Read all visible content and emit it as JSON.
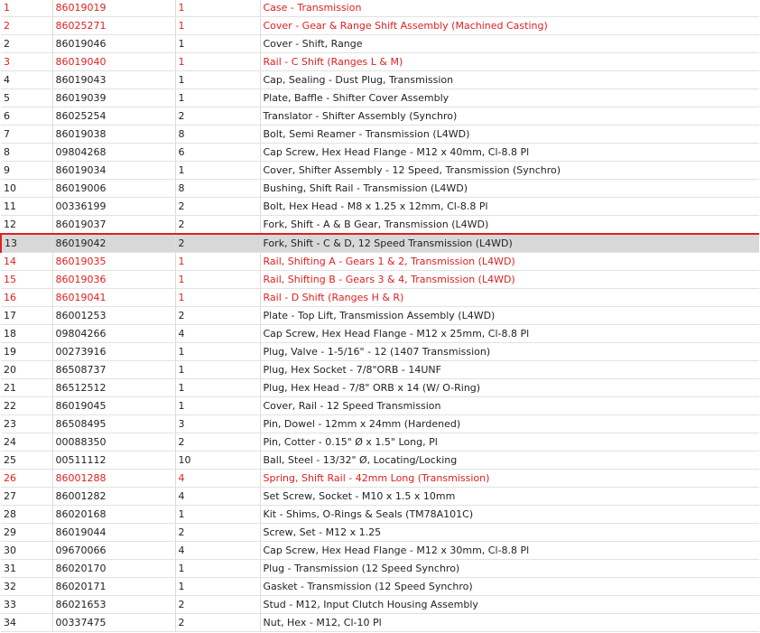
{
  "parts_table": {
    "selected_ref": "13",
    "rows": [
      {
        "ref": "1",
        "part_number": "86019019",
        "qty": "1",
        "description": "Case - Transmission",
        "highlight": "red"
      },
      {
        "ref": "2",
        "part_number": "86025271",
        "qty": "1",
        "description": "Cover - Gear & Range Shift Assembly (Machined Casting)",
        "highlight": "red"
      },
      {
        "ref": "2",
        "part_number": "86019046",
        "qty": "1",
        "description": "Cover - Shift, Range",
        "highlight": "none"
      },
      {
        "ref": "3",
        "part_number": "86019040",
        "qty": "1",
        "description": "Rail - C Shift (Ranges L & M)",
        "highlight": "red"
      },
      {
        "ref": "4",
        "part_number": "86019043",
        "qty": "1",
        "description": "Cap, Sealing - Dust Plug, Transmission",
        "highlight": "none"
      },
      {
        "ref": "5",
        "part_number": "86019039",
        "qty": "1",
        "description": "Plate, Baffle - Shifter Cover Assembly",
        "highlight": "none"
      },
      {
        "ref": "6",
        "part_number": "86025254",
        "qty": "2",
        "description": "Translator - Shifter Assembly (Synchro)",
        "highlight": "none"
      },
      {
        "ref": "7",
        "part_number": "86019038",
        "qty": "8",
        "description": "Bolt, Semi Reamer - Transmission (L4WD)",
        "highlight": "none"
      },
      {
        "ref": "8",
        "part_number": "09804268",
        "qty": "6",
        "description": "Cap Screw, Hex Head Flange - M12 x 40mm, Cl-8.8 Pl",
        "highlight": "none"
      },
      {
        "ref": "9",
        "part_number": "86019034",
        "qty": "1",
        "description": "Cover, Shifter Assembly - 12 Speed, Transmission (Synchro)",
        "highlight": "none"
      },
      {
        "ref": "10",
        "part_number": "86019006",
        "qty": "8",
        "description": "Bushing, Shift Rail - Transmission (L4WD)",
        "highlight": "none"
      },
      {
        "ref": "11",
        "part_number": "00336199",
        "qty": "2",
        "description": "Bolt, Hex Head - M8 x 1.25 x 12mm, Cl-8.8 Pl",
        "highlight": "none"
      },
      {
        "ref": "12",
        "part_number": "86019037",
        "qty": "2",
        "description": "Fork, Shift - A & B Gear, Transmission (L4WD)",
        "highlight": "none"
      },
      {
        "ref": "13",
        "part_number": "86019042",
        "qty": "2",
        "description": "Fork, Shift - C & D, 12 Speed Transmission (L4WD)",
        "highlight": "selected"
      },
      {
        "ref": "14",
        "part_number": "86019035",
        "qty": "1",
        "description": "Rail, Shifting A - Gears 1 & 2, Transmission (L4WD)",
        "highlight": "red"
      },
      {
        "ref": "15",
        "part_number": "86019036",
        "qty": "1",
        "description": "Rail, Shifting B - Gears 3 & 4, Transmission (L4WD)",
        "highlight": "red"
      },
      {
        "ref": "16",
        "part_number": "86019041",
        "qty": "1",
        "description": "Rail - D Shift (Ranges H & R)",
        "highlight": "red"
      },
      {
        "ref": "17",
        "part_number": "86001253",
        "qty": "2",
        "description": "Plate - Top Lift, Transmission Assembly (L4WD)",
        "highlight": "none"
      },
      {
        "ref": "18",
        "part_number": "09804266",
        "qty": "4",
        "description": "Cap Screw, Hex Head Flange - M12 x 25mm, Cl-8.8 Pl",
        "highlight": "none"
      },
      {
        "ref": "19",
        "part_number": "00273916",
        "qty": "1",
        "description": "Plug, Valve - 1-5/16\" - 12 (1407 Transmission)",
        "highlight": "none"
      },
      {
        "ref": "20",
        "part_number": "86508737",
        "qty": "1",
        "description": "Plug, Hex Socket - 7/8\"ORB - 14UNF",
        "highlight": "none"
      },
      {
        "ref": "21",
        "part_number": "86512512",
        "qty": "1",
        "description": "Plug, Hex Head - 7/8\" ORB x 14 (W/ O-Ring)",
        "highlight": "none"
      },
      {
        "ref": "22",
        "part_number": "86019045",
        "qty": "1",
        "description": "Cover, Rail - 12 Speed Transmission",
        "highlight": "none"
      },
      {
        "ref": "23",
        "part_number": "86508495",
        "qty": "3",
        "description": "Pin, Dowel - 12mm x 24mm (Hardened)",
        "highlight": "none"
      },
      {
        "ref": "24",
        "part_number": "00088350",
        "qty": "2",
        "description": "Pin, Cotter - 0.15\" Ø x 1.5\" Long, Pl",
        "highlight": "none"
      },
      {
        "ref": "25",
        "part_number": "00511112",
        "qty": "10",
        "description": "Ball, Steel - 13/32\" Ø, Locating/Locking",
        "highlight": "none"
      },
      {
        "ref": "26",
        "part_number": "86001288",
        "qty": "4",
        "description": "Spring, Shift Rail - 42mm Long (Transmission)",
        "highlight": "red"
      },
      {
        "ref": "27",
        "part_number": "86001282",
        "qty": "4",
        "description": "Set Screw, Socket - M10 x 1.5 x 10mm",
        "highlight": "none"
      },
      {
        "ref": "28",
        "part_number": "86020168",
        "qty": "1",
        "description": "Kit - Shims, O-Rings & Seals (TM78A101C)",
        "highlight": "none"
      },
      {
        "ref": "29",
        "part_number": "86019044",
        "qty": "2",
        "description": "Screw, Set - M12 x 1.25",
        "highlight": "none"
      },
      {
        "ref": "30",
        "part_number": "09670066",
        "qty": "4",
        "description": "Cap Screw, Hex Head Flange - M12 x 30mm, Cl-8.8 Pl",
        "highlight": "none"
      },
      {
        "ref": "31",
        "part_number": "86020170",
        "qty": "1",
        "description": "Plug - Transmission (12 Speed Synchro)",
        "highlight": "none"
      },
      {
        "ref": "32",
        "part_number": "86020171",
        "qty": "1",
        "description": "Gasket - Transmission (12 Speed Synchro)",
        "highlight": "none"
      },
      {
        "ref": "33",
        "part_number": "86021653",
        "qty": "2",
        "description": "Stud - M12, Input Clutch Housing Assembly",
        "highlight": "none"
      },
      {
        "ref": "34",
        "part_number": "00337475",
        "qty": "2",
        "description": "Nut, Hex - M12, Cl-10 Pl",
        "highlight": "none"
      }
    ]
  },
  "colors": {
    "highlight_red": "#e02020",
    "selected_background": "#d8d8d8",
    "text_default": "#222222"
  }
}
